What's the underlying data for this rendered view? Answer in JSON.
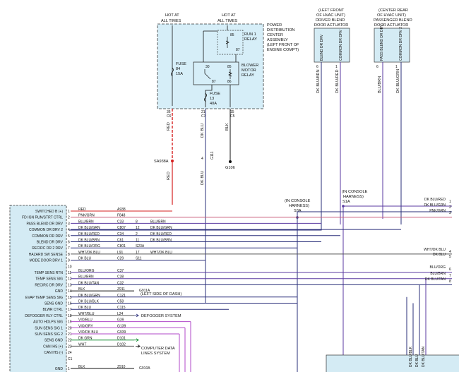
{
  "pdc": {
    "hot_left": [
      "HOT AT",
      "ALL TIMES"
    ],
    "hot_right": [
      "HOT AT",
      "ALL TIMES"
    ],
    "title": [
      "POWER",
      "DISTRIBUTION",
      "CENTER",
      "ASSEMBLY",
      "(LEFT FRONT OF",
      "ENGINE COMPT)"
    ],
    "run_relay": [
      "RUN 1",
      "RELAY"
    ],
    "blower_relay": [
      "BLOWER",
      "MOTOR",
      "RELAY"
    ],
    "fuse84": [
      "FUSE",
      "84",
      "15A"
    ],
    "fuse13": [
      "FUSE",
      "13",
      "40A"
    ],
    "relay_pins": {
      "p30": "30",
      "p85": "85",
      "p86": "86",
      "p87": "87",
      "r85": "85",
      "r87": "87"
    },
    "cav_a": "36",
    "cav_b": "21",
    "cav_c": "15",
    "cav_a_sub": "C6",
    "cav_b_sub": "C3",
    "cav_c_sub": "C5"
  },
  "top_wires": {
    "red": "RED",
    "red2": "RED",
    "splice": "SA938A",
    "dkblu": "DK BLU",
    "blk": "BLK",
    "ground": "G106",
    "g111": "G111",
    "cav4": "4"
  },
  "actuators": {
    "driver": {
      "title": [
        "(LEFT FRONT",
        "OF HVAC UNIT)",
        "DRIVER BLEND",
        "DOOR ACTUATOR"
      ],
      "pin1": "BLEND DR DRV",
      "pin2": "COMMON DR DRV",
      "wire1": "DK BLU/BRN",
      "wire2": "DK BLU/RED",
      "cav1": "6",
      "cav2": "1"
    },
    "passenger": {
      "title": [
        "(CENTER REAR",
        "OF HVAC UNIT)",
        "PASSENGER BLEND",
        "DOOR ACTUATOR"
      ],
      "pin1": "PASS BLEND DR DRV",
      "pin2": "COMMON DR DRV 2",
      "wire1": "BLU/BRN",
      "wire2": "DK BLU/GRN",
      "cav1": "6",
      "cav2": "1"
    }
  },
  "console": {
    "left": [
      "(IN CONSOLE",
      "HARNESS)",
      "S3A"
    ],
    "right": [
      "(IN CONSOLE",
      "HARNESS)",
      "S1A"
    ]
  },
  "module_pins": [
    {
      "label": "SWITCHED B (+)",
      "n": "1"
    },
    {
      "label": "FD IGN RUN/STRT CTRL",
      "n": "2"
    },
    {
      "label": "PASS BLEND DR DRV",
      "n": "3"
    },
    {
      "label": "COMMON DR DRV 2",
      "n": "4"
    },
    {
      "label": "COMMON DR DRV",
      "n": "5"
    },
    {
      "label": "BLEND DR DRV",
      "n": "6"
    },
    {
      "label": "RECIRC DR 2 DRV",
      "n": "7"
    },
    {
      "label": "HAZARD SW SENSE",
      "n": "8"
    },
    {
      "label": "MODE DOOR DRV 1",
      "n": "9"
    },
    {
      "label": "",
      "n": "10"
    },
    {
      "label": "TEMP SENS RTN",
      "n": "11"
    },
    {
      "label": "TEMP SENS SIG",
      "n": "12"
    },
    {
      "label": "RECIRC DR DRV",
      "n": "13"
    },
    {
      "label": "GND",
      "n": "14"
    },
    {
      "label": "EVAP TEMP SENS SIG",
      "n": "15"
    },
    {
      "label": "SENS GND",
      "n": "16"
    },
    {
      "label": "BLWR CTRL",
      "n": "17"
    },
    {
      "label": "DEFOGGER RLY CTRL",
      "n": "18"
    },
    {
      "label": "AUTO HDLPS SIG",
      "n": "19"
    },
    {
      "label": "SUN SENS SIG 1",
      "n": "20"
    },
    {
      "label": "SUN SENS SIG 2",
      "n": "21"
    },
    {
      "label": "SENS GND",
      "n": "22"
    },
    {
      "label": "CAN IHS (+)",
      "n": "23"
    },
    {
      "label": "CAN IHS (-)",
      "n": "24"
    },
    {
      "label": "",
      "n": "C1"
    },
    {
      "label": "GND",
      "n": "1"
    }
  ],
  "wires": [
    {
      "color": "RED",
      "circuit": "A938"
    },
    {
      "color": "PNK/GRN",
      "circuit": "F848"
    },
    {
      "color": "BLU/BRN",
      "circuit": "C33",
      "splice": "8",
      "after": "BLU/BRN"
    },
    {
      "color": "DK BLU/GRN",
      "circuit": "C807",
      "splice": "12",
      "after": "DK BLU/GRN"
    },
    {
      "color": "DK BLU/RED",
      "circuit": "C34",
      "splice": "2",
      "after": "DK BLU/RED"
    },
    {
      "color": "DK BLU/BRN",
      "circuit": "C61",
      "splice": "11",
      "after": "DK BLU/BRN"
    },
    {
      "color": "DK BLU/ORG",
      "circuit": "C801",
      "splice": "S23A",
      "after": ""
    },
    {
      "color": "WHT/DK BLU",
      "circuit": "L91",
      "splice": "17",
      "after": "WHT/DK BLU"
    },
    {
      "color": "DK BLU",
      "circuit": "C29",
      "splice": "S11",
      "after": ""
    },
    {
      "color": "",
      "circuit": ""
    },
    {
      "color": "BLU/ORG",
      "circuit": "C37"
    },
    {
      "color": "BLU/BRN",
      "circuit": "C38"
    },
    {
      "color": "DK BLU/TAN",
      "circuit": "C32"
    },
    {
      "color": "BLK",
      "circuit": "Z911",
      "note": "G911A"
    },
    {
      "color": "DK BLU/GRN",
      "circuit": "C121"
    },
    {
      "color": "DK BLU/BLK",
      "circuit": "C58"
    },
    {
      "color": "DK BLU",
      "circuit": "C115"
    },
    {
      "color": "WHT/BLU",
      "circuit": "L24"
    },
    {
      "color": "VIO/BLU",
      "circuit": "G39"
    },
    {
      "color": "VIO/GRY",
      "circuit": "G139"
    },
    {
      "color": "VIO/DK BLU",
      "circuit": "G939"
    },
    {
      "color": "DK GRN",
      "circuit": "D101"
    },
    {
      "color": "WHT",
      "circuit": "D102"
    },
    {
      "color": "",
      "circuit": ""
    },
    {
      "color": "",
      "circuit": ""
    },
    {
      "color": "BLK",
      "circuit": "Z910",
      "note": "G910A"
    }
  ],
  "notes": {
    "dash": "(LEFT SIDE OF DASH)",
    "defogger": "DEFOGGER SYSTEM",
    "comp_data": [
      "COMPUTER DATA",
      "LINES SYSTEM"
    ]
  },
  "right_labels": [
    {
      "text": "DK BLU/RED",
      "n": "1"
    },
    {
      "text": "DK BLU/GRN",
      "n": "2"
    },
    {
      "text": "PNK/GRN",
      "n": "3"
    },
    {
      "text": "WHT/DK BLU",
      "n": "4"
    },
    {
      "text": "DK BLU",
      "n": "5"
    },
    {
      "text": "BLU/ORG",
      "n": "6"
    },
    {
      "text": "BLU/BRN",
      "n": "7"
    },
    {
      "text": "DK BLU/TAN",
      "n": "8"
    }
  ],
  "bottom_verticals": [
    "DK BLU/BLK",
    "DK BLU",
    "DK BLU/TAN"
  ],
  "colors": {
    "red": "#d62020",
    "pink": "#f05aa0",
    "pnk_grn": "#c85a78",
    "dkblue": "#2a2f7a",
    "purple": "#5a3aa0",
    "violet": "#b048c8",
    "green": "#0a8a2a",
    "black": "#111111",
    "pdc_fill": "#d6eef8",
    "module_fill": "#d4ebf4",
    "grey": "#555555"
  }
}
